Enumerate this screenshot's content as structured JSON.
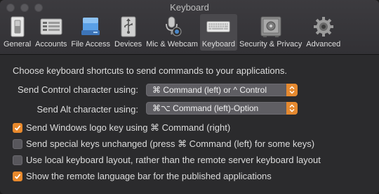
{
  "window": {
    "title": "Keyboard"
  },
  "toolbar": {
    "items": [
      {
        "label": "General",
        "icon": "switch-icon"
      },
      {
        "label": "Accounts",
        "icon": "accounts-icon"
      },
      {
        "label": "File Access",
        "icon": "drive-icon"
      },
      {
        "label": "Devices",
        "icon": "usb-icon"
      },
      {
        "label": "Mic & Webcam",
        "icon": "microphone-icon"
      },
      {
        "label": "Keyboard",
        "icon": "keyboard-icon",
        "active": true
      },
      {
        "label": "Security & Privacy",
        "icon": "safe-icon"
      },
      {
        "label": "Advanced",
        "icon": "gear-icon"
      }
    ]
  },
  "main": {
    "heading": "Choose keyboard shortcuts to send commands to your applications.",
    "control": {
      "label": "Send Control character using:",
      "value": "⌘ Command (left) or ^ Control"
    },
    "alt": {
      "label": "Send Alt character using:",
      "value": "⌘⌥ Command (left)-Option"
    },
    "options": [
      {
        "label": "Send Windows logo key using ⌘ Command (right)",
        "checked": true
      },
      {
        "label": "Send special keys unchanged (press ⌘ Command (left) for some keys)",
        "checked": false
      },
      {
        "label": "Use local keyboard layout, rather than the remote server keyboard layout",
        "checked": false
      },
      {
        "label": "Show the remote language bar for the published applications",
        "checked": true
      }
    ]
  },
  "colors": {
    "accent": "#e8892c",
    "background": "#2b2b2d"
  }
}
